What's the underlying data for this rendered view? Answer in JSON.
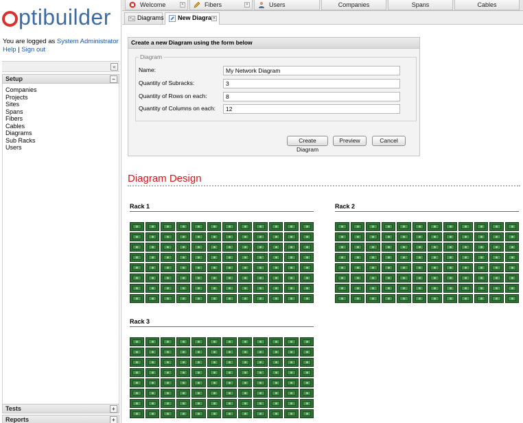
{
  "app": {
    "logo_rest": "ptibuilder",
    "logo_color_o": "#d8322a",
    "logo_color_text": "#3d6aa4"
  },
  "login": {
    "prefix": "You are logged as ",
    "user": "System Administrator",
    "help": "Help",
    "separator": "|",
    "signout": "Sign out"
  },
  "sidebar": {
    "collapse_icon": "double-chevron-left-icon",
    "setup": {
      "title": "Setup",
      "toggle": "−",
      "items": [
        "Companies",
        "Projects",
        "Sites",
        "Spans",
        "Fibers",
        "Cables",
        "Diagrams",
        "Sub Racks",
        "Users"
      ]
    },
    "tests": {
      "title": "Tests",
      "toggle": "+"
    },
    "reports": {
      "title": "Reports",
      "toggle": "+"
    }
  },
  "tabs": [
    {
      "label": "Welcome",
      "icon": "stop-icon"
    },
    {
      "label": "Fibers",
      "icon": "pencil-icon"
    },
    {
      "label": "Users",
      "icon": "user-icon"
    },
    {
      "label": "Companies",
      "icon": ""
    },
    {
      "label": "Spans",
      "icon": ""
    },
    {
      "label": "Cables",
      "icon": ""
    }
  ],
  "subtabs": [
    {
      "label": "Diagrams",
      "icon": "diagram-icon"
    },
    {
      "label": "New Diagram",
      "icon": "edit-icon"
    }
  ],
  "form": {
    "title": "Create a new Diagram using the form below",
    "legend": "Diagram",
    "fields": [
      {
        "label": "Name:",
        "value": "My Network Diagram"
      },
      {
        "label": "Quantity of Subracks:",
        "value": "3"
      },
      {
        "label": "Quantity of Rows on each:",
        "value": "8"
      },
      {
        "label": "Quantity of Columns on each:",
        "value": "12"
      }
    ],
    "buttons": {
      "create": "Create Diagram",
      "preview": "Preview",
      "cancel": "Cancel"
    }
  },
  "design": {
    "title": "Diagram Design",
    "title_color": "#d2161a",
    "racks": [
      {
        "title": "Rack 1",
        "rows": 8,
        "cols": 12
      },
      {
        "title": "Rack 2",
        "rows": 8,
        "cols": 12
      },
      {
        "title": "Rack 3",
        "rows": 8,
        "cols": 12
      }
    ]
  }
}
